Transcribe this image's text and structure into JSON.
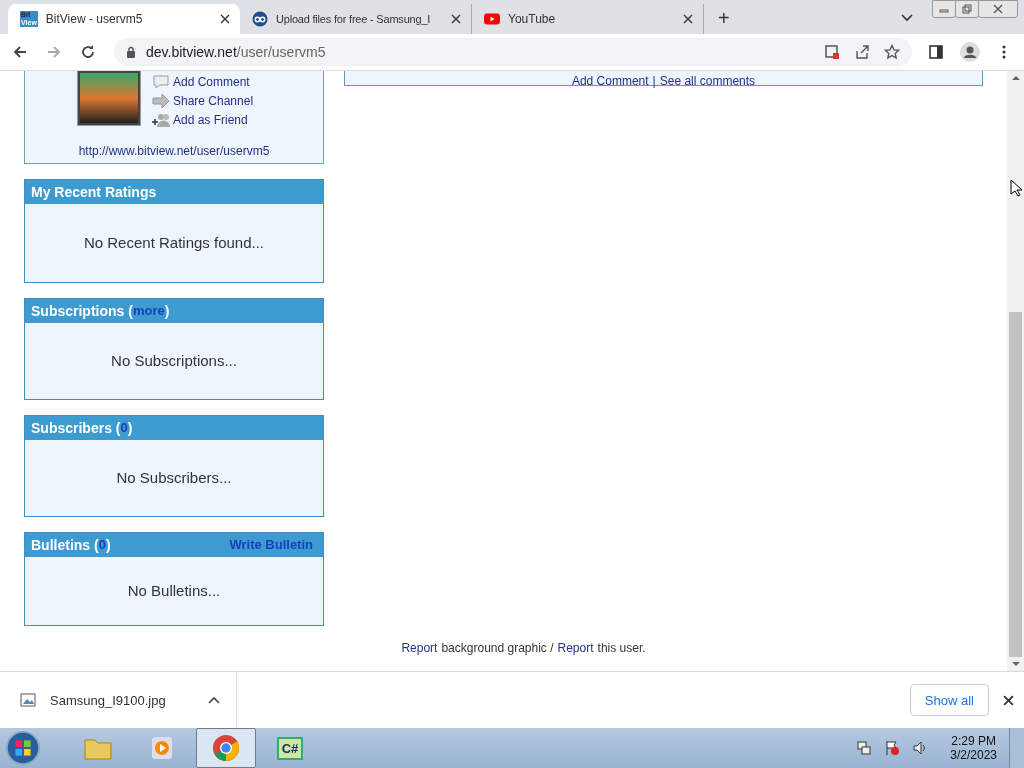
{
  "browser": {
    "tabs": [
      {
        "title": "BitView - uservm5",
        "selected": true
      },
      {
        "title": "Upload files for free - Samsung_I",
        "selected": false
      },
      {
        "title": "YouTube",
        "selected": false
      }
    ],
    "favicon_text": [
      "Bit",
      "View"
    ],
    "new_tab": "+",
    "address": {
      "host": "dev.bitview.net",
      "path": "/user/uservm5"
    }
  },
  "profile_card": {
    "links": [
      "Add Comment",
      "Share Channel",
      "Add as Friend"
    ],
    "url": "http://www.bitview.net/user/uservm5"
  },
  "comments_box": {
    "links": [
      "Add Comment",
      "See all comments"
    ],
    "separator": "|"
  },
  "sections": [
    {
      "kind": "plain",
      "title": "My Recent Ratings",
      "empty": "No Recent Ratings found..."
    },
    {
      "kind": "counted",
      "title": "Subscriptions (",
      "link": "more",
      "close": ")",
      "empty": "No Subscriptions..."
    },
    {
      "kind": "counted",
      "title": "Subscribers (",
      "link": "0",
      "close": ")",
      "empty": "No Subscribers..."
    },
    {
      "kind": "action",
      "title": "Bulletins (",
      "link": "0",
      "close": ")",
      "action": "Write Bulletin",
      "empty": "No Bulletins..."
    }
  ],
  "footer": {
    "parts": [
      {
        "kind": "link",
        "text": "Report"
      },
      {
        "kind": "text",
        "text": "background graphic /"
      },
      {
        "kind": "link",
        "text": "Report"
      },
      {
        "kind": "text",
        "text": "this user."
      }
    ]
  },
  "downloads": {
    "file": "Samsung_I9100.jpg",
    "show_all": "Show all"
  },
  "taskbar": {
    "apps": [
      {
        "kind": "explorer",
        "selected": false
      },
      {
        "kind": "media",
        "selected": false
      },
      {
        "kind": "chrome",
        "selected": true
      },
      {
        "kind": "csharp",
        "label": "C#",
        "selected": false
      }
    ],
    "time": "2:29 PM",
    "date": "3/2/2023"
  }
}
